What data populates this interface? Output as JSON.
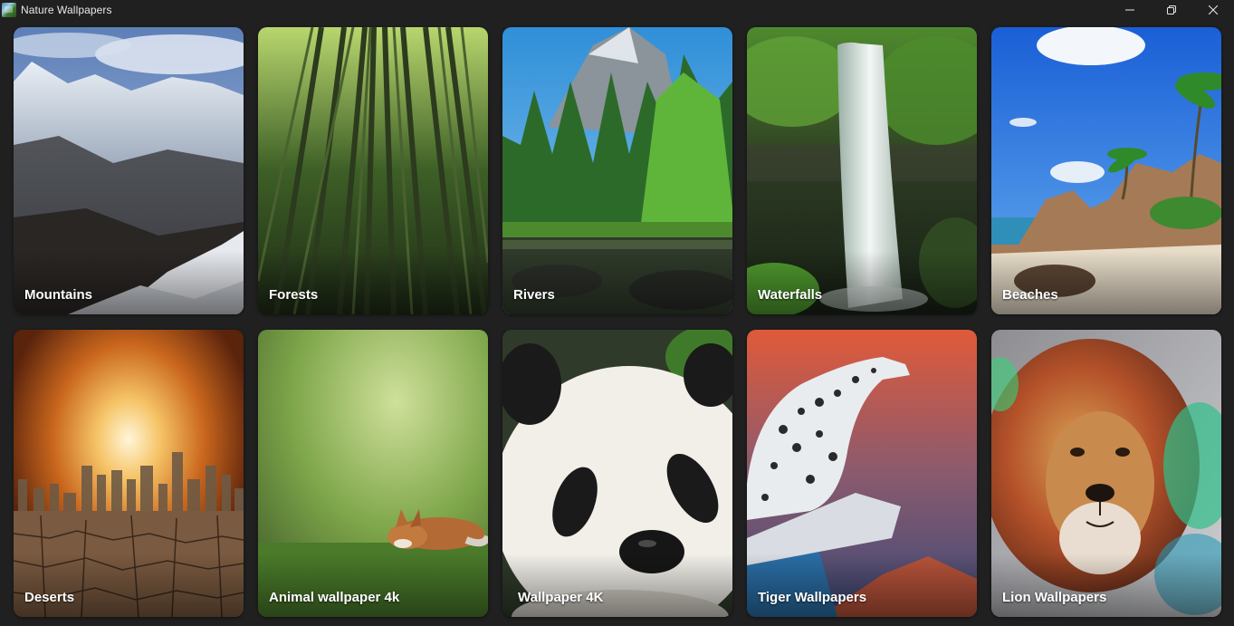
{
  "window": {
    "title": "Nature Wallpapers",
    "icon": "app-landscape-icon",
    "controls": [
      "minimize-icon",
      "restore-icon",
      "close-icon"
    ]
  },
  "categories": [
    {
      "label": "Mountains",
      "icon": "mountain-image"
    },
    {
      "label": "Forests",
      "icon": "forest-image"
    },
    {
      "label": "Rivers",
      "icon": "river-image"
    },
    {
      "label": "Waterfalls",
      "icon": "waterfall-image"
    },
    {
      "label": "Beaches",
      "icon": "beach-image"
    },
    {
      "label": "Deserts",
      "icon": "desert-image"
    },
    {
      "label": "Animal wallpaper 4k",
      "icon": "fox-image"
    },
    {
      "label": "Wallpaper 4K",
      "icon": "panda-image"
    },
    {
      "label": "Tiger Wallpapers",
      "icon": "snow-leopard-image"
    },
    {
      "label": "Lion Wallpapers",
      "icon": "lion-image"
    }
  ],
  "colors": {
    "background": "#202020",
    "label_text": "#ffffff",
    "title_text": "#e8e8e8"
  }
}
